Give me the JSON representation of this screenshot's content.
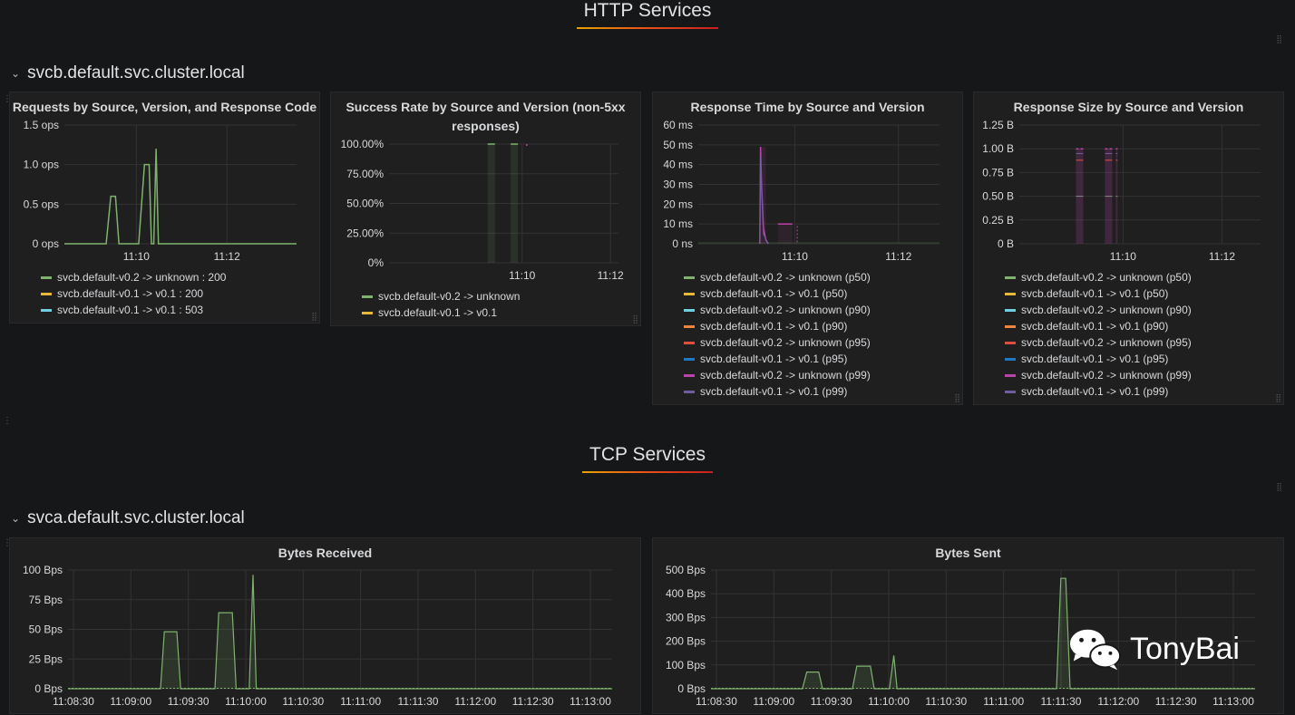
{
  "sections": {
    "http_title": "HTTP Services",
    "tcp_title": "TCP Services"
  },
  "rows": {
    "svcb": "svcb.default.svc.cluster.local",
    "svca": "svca.default.svc.cluster.local"
  },
  "watermark": "TonyBai",
  "colors": {
    "green": "#7eb26d",
    "yellow": "#eab839",
    "cyan": "#6ed0e0",
    "orange": "#ef843c",
    "red": "#e24d42",
    "blue": "#1f78c1",
    "magenta": "#ba43a9",
    "purple": "#705da0"
  },
  "panels": {
    "requests": {
      "title": "Requests by Source, Version, and Response Code",
      "legend": [
        {
          "label": "svcb.default-v0.2 -> unknown : 200",
          "color": "#7eb26d"
        },
        {
          "label": "svcb.default-v0.1 -> v0.1 : 200",
          "color": "#eab839"
        },
        {
          "label": "svcb.default-v0.1 -> v0.1 : 503",
          "color": "#6ed0e0"
        }
      ]
    },
    "success": {
      "title": "Success Rate by Source and Version (non-5xx responses)",
      "legend": [
        {
          "label": "svcb.default-v0.2 -> unknown",
          "color": "#7eb26d"
        },
        {
          "label": "svcb.default-v0.1 -> v0.1",
          "color": "#eab839"
        }
      ]
    },
    "resptime": {
      "title": "Response Time by Source and Version",
      "legend": [
        {
          "label": "svcb.default-v0.2 -> unknown (p50)",
          "color": "#7eb26d"
        },
        {
          "label": "svcb.default-v0.1 -> v0.1 (p50)",
          "color": "#eab839"
        },
        {
          "label": "svcb.default-v0.2 -> unknown (p90)",
          "color": "#6ed0e0"
        },
        {
          "label": "svcb.default-v0.1 -> v0.1 (p90)",
          "color": "#ef843c"
        },
        {
          "label": "svcb.default-v0.2 -> unknown (p95)",
          "color": "#e24d42"
        },
        {
          "label": "svcb.default-v0.1 -> v0.1 (p95)",
          "color": "#1f78c1"
        },
        {
          "label": "svcb.default-v0.2 -> unknown (p99)",
          "color": "#ba43a9"
        },
        {
          "label": "svcb.default-v0.1 -> v0.1 (p99)",
          "color": "#705da0"
        }
      ]
    },
    "respsize": {
      "title": "Response Size by Source and Version",
      "legend": [
        {
          "label": "svcb.default-v0.2 -> unknown (p50)",
          "color": "#7eb26d"
        },
        {
          "label": "svcb.default-v0.1 -> v0.1 (p50)",
          "color": "#eab839"
        },
        {
          "label": "svcb.default-v0.2 -> unknown (p90)",
          "color": "#6ed0e0"
        },
        {
          "label": "svcb.default-v0.1 -> v0.1 (p90)",
          "color": "#ef843c"
        },
        {
          "label": "svcb.default-v0.2 -> unknown (p95)",
          "color": "#e24d42"
        },
        {
          "label": "svcb.default-v0.1 -> v0.1 (p95)",
          "color": "#1f78c1"
        },
        {
          "label": "svcb.default-v0.2 -> unknown (p99)",
          "color": "#ba43a9"
        },
        {
          "label": "svcb.default-v0.1 -> v0.1 (p99)",
          "color": "#705da0"
        }
      ]
    },
    "bytes_received": {
      "title": "Bytes Received"
    },
    "bytes_sent": {
      "title": "Bytes Sent"
    }
  },
  "chart_data": [
    {
      "id": "requests",
      "type": "line",
      "title": "Requests by Source, Version, and Response Code",
      "y_ticks": [
        "1.5 ops",
        "1.0 ops",
        "0.5 ops",
        "0 ops"
      ],
      "ylim": [
        0,
        1.5
      ],
      "x_ticks": [
        "11:10",
        "11:12"
      ],
      "series": [
        {
          "name": "svcb.default-v0.2 -> unknown : 200",
          "points": [
            [
              0,
              0
            ],
            [
              0.18,
              0
            ],
            [
              0.2,
              0.6
            ],
            [
              0.22,
              0.6
            ],
            [
              0.235,
              0
            ],
            [
              0.32,
              0
            ],
            [
              0.335,
              0.6
            ],
            [
              0.345,
              1.0
            ],
            [
              0.365,
              1.0
            ],
            [
              0.375,
              0
            ],
            [
              0.385,
              0
            ],
            [
              0.395,
              1.2
            ],
            [
              0.405,
              0
            ],
            [
              1,
              0
            ]
          ]
        }
      ]
    },
    {
      "id": "success",
      "type": "bar",
      "title": "Success Rate by Source and Version (non-5xx responses)",
      "y_ticks": [
        "100.00%",
        "75.00%",
        "50.00%",
        "25.00%",
        "0%"
      ],
      "ylim": [
        0,
        100
      ],
      "x_ticks": [
        "11:10",
        "11:12"
      ],
      "series": [
        {
          "name": "svcb.default-v0.2 -> unknown",
          "values": [
            100,
            100
          ]
        }
      ]
    },
    {
      "id": "resptime",
      "type": "line",
      "title": "Response Time by Source and Version",
      "y_ticks": [
        "60 ms",
        "50 ms",
        "40 ms",
        "30 ms",
        "20 ms",
        "10 ms",
        "0 ns"
      ],
      "ylim": [
        0,
        60
      ],
      "x_ticks": [
        "11:10",
        "11:12"
      ],
      "peaks_ms": [
        49,
        10,
        9
      ]
    },
    {
      "id": "respsize",
      "type": "bar",
      "title": "Response Size by Source and Version",
      "y_ticks": [
        "1.25 B",
        "1.00 B",
        "0.75 B",
        "0.50 B",
        "0.25 B",
        "0 B"
      ],
      "ylim": [
        0,
        1.25
      ],
      "x_ticks": [
        "11:10",
        "11:12"
      ],
      "values_b": [
        1.0,
        1.0,
        1.0
      ]
    },
    {
      "id": "bytes_received",
      "type": "area",
      "title": "Bytes Received",
      "y_ticks": [
        "100 Bps",
        "75 Bps",
        "50 Bps",
        "25 Bps",
        "0 Bps"
      ],
      "ylim": [
        0,
        100
      ],
      "x_ticks": [
        "11:08:30",
        "11:09:00",
        "11:09:30",
        "11:10:00",
        "11:10:30",
        "11:11:00",
        "11:11:30",
        "11:12:00",
        "11:12:30",
        "11:13:00"
      ],
      "points": [
        [
          0,
          0
        ],
        [
          0.17,
          0
        ],
        [
          0.177,
          48
        ],
        [
          0.2,
          48
        ],
        [
          0.207,
          0
        ],
        [
          0.27,
          0
        ],
        [
          0.277,
          64
        ],
        [
          0.302,
          64
        ],
        [
          0.309,
          0
        ],
        [
          0.333,
          0
        ],
        [
          0.34,
          96
        ],
        [
          0.346,
          0
        ],
        [
          1,
          0
        ]
      ]
    },
    {
      "id": "bytes_sent",
      "type": "area",
      "title": "Bytes Sent",
      "y_ticks": [
        "500 Bps",
        "400 Bps",
        "300 Bps",
        "200 Bps",
        "100 Bps",
        "0 Bps"
      ],
      "ylim": [
        0,
        500
      ],
      "x_ticks": [
        "11:08:30",
        "11:09:00",
        "11:09:30",
        "11:10:00",
        "11:10:30",
        "11:11:00",
        "11:11:30",
        "11:12:00",
        "11:12:30",
        "11:13:00"
      ],
      "points": [
        [
          0,
          0
        ],
        [
          0.168,
          0
        ],
        [
          0.176,
          70
        ],
        [
          0.198,
          70
        ],
        [
          0.205,
          0
        ],
        [
          0.26,
          0
        ],
        [
          0.268,
          95
        ],
        [
          0.293,
          95
        ],
        [
          0.3,
          0
        ],
        [
          0.328,
          0
        ],
        [
          0.336,
          140
        ],
        [
          0.342,
          0
        ],
        [
          0.635,
          0
        ],
        [
          0.643,
          465
        ],
        [
          0.652,
          465
        ],
        [
          0.66,
          0
        ],
        [
          1,
          0
        ]
      ]
    }
  ]
}
